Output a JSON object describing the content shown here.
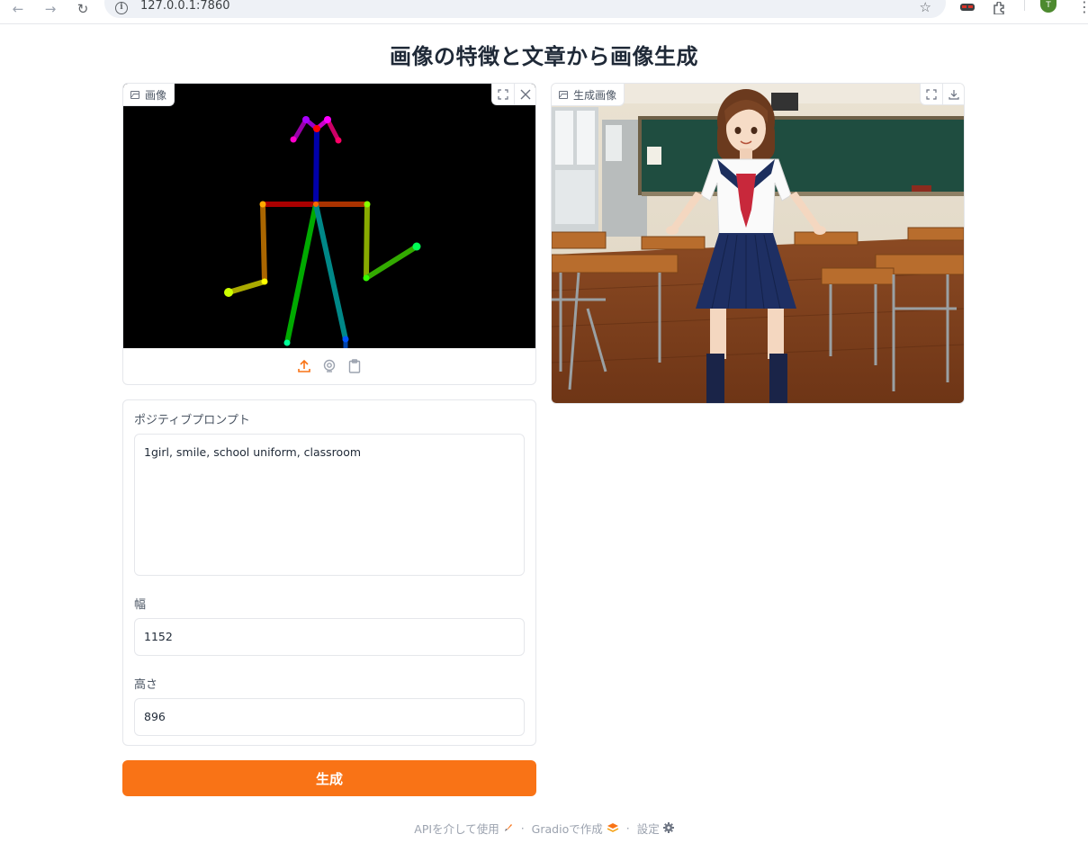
{
  "browser": {
    "url": "127.0.0.1:7860",
    "profile_initial": "T"
  },
  "page": {
    "title": "画像の特徴と文章から画像生成"
  },
  "input_image": {
    "label": "画像",
    "icons": [
      "image-icon",
      "fullscreen-icon",
      "close-icon",
      "upload-icon",
      "webcam-icon",
      "clipboard-icon"
    ]
  },
  "output_image": {
    "label": "生成画像",
    "icons": [
      "image-icon",
      "fullscreen-icon",
      "download-icon"
    ]
  },
  "form": {
    "prompt_label": "ポジティブプロンプト",
    "prompt_value": "1girl, smile, school uniform, classroom",
    "width_label": "幅",
    "width_value": "1152",
    "height_label": "高さ",
    "height_value": "896"
  },
  "generate_button": {
    "label": "生成"
  },
  "footer": {
    "api_link": "APIを介して使用",
    "separator": "·",
    "gradio_link": "Gradioで作成",
    "settings_link": "設定"
  },
  "colors": {
    "accent": "#f97316",
    "border": "#e5e7eb",
    "canvas_bg": "#000000"
  }
}
